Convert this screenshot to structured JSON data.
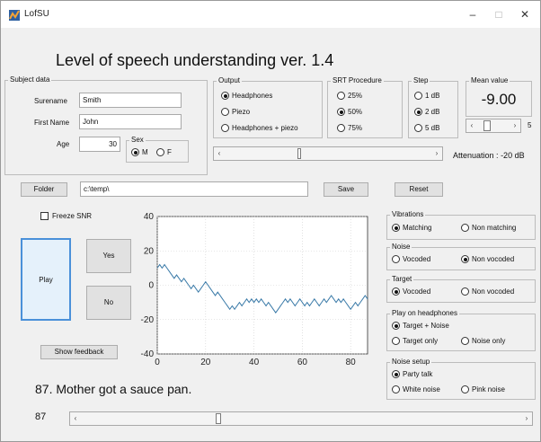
{
  "window": {
    "title": "LofSU",
    "minimize": "–",
    "maximize": "□",
    "close": "✕"
  },
  "header": {
    "title": "Level of speech understanding ver. 1.4"
  },
  "subject": {
    "group_label": "Subject data",
    "surename_label": "Surename",
    "surename_value": "Smith",
    "firstname_label": "First Name",
    "firstname_value": "John",
    "age_label": "Age",
    "age_value": "30",
    "sex": {
      "label": "Sex",
      "options": [
        {
          "label": "M",
          "selected": true
        },
        {
          "label": "F",
          "selected": false
        }
      ]
    }
  },
  "output": {
    "label": "Output",
    "options": [
      {
        "label": "Headphones",
        "selected": true
      },
      {
        "label": "Piezo",
        "selected": false
      },
      {
        "label": "Headphones + piezo",
        "selected": false
      }
    ]
  },
  "srt": {
    "label": "SRT Procedure",
    "options": [
      {
        "label": "25%",
        "selected": false
      },
      {
        "label": "50%",
        "selected": true
      },
      {
        "label": "75%",
        "selected": false
      }
    ]
  },
  "step": {
    "label": "Step",
    "options": [
      {
        "label": "1 dB",
        "selected": false
      },
      {
        "label": "2 dB",
        "selected": true
      },
      {
        "label": "5 dB",
        "selected": false
      }
    ]
  },
  "mean": {
    "label": "Mean value",
    "value": "-9.00",
    "slider_value": "5",
    "slider_fraction": 0.25
  },
  "attenuation": {
    "label": "Attenuation :",
    "value": "-20",
    "unit": "dB",
    "slider_fraction": 0.36
  },
  "toolbar": {
    "folder_label": "Folder",
    "folder_path": "c:\\temp\\",
    "save_label": "Save",
    "reset_label": "Reset"
  },
  "controls": {
    "freeze_label": "Freeze SNR",
    "freeze_checked": false,
    "play_label": "Play",
    "yes_label": "Yes",
    "no_label": "No",
    "feedback_label": "Show feedback"
  },
  "vibrations": {
    "label": "Vibrations",
    "options": [
      {
        "label": "Matching",
        "selected": true
      },
      {
        "label": "Non matching",
        "selected": false
      }
    ]
  },
  "noise": {
    "label": "Noise",
    "options": [
      {
        "label": "Vocoded",
        "selected": false
      },
      {
        "label": "Non vocoded",
        "selected": true
      }
    ]
  },
  "target": {
    "label": "Target",
    "options": [
      {
        "label": "Vocoded",
        "selected": true
      },
      {
        "label": "Non vocoded",
        "selected": false
      }
    ]
  },
  "play_on_headphones": {
    "label": "Play on headphones",
    "options": [
      {
        "label": "Target + Noise",
        "selected": true
      },
      {
        "label": "Target only",
        "selected": false
      },
      {
        "label": "Noise only",
        "selected": false
      }
    ]
  },
  "noise_setup": {
    "label": "Noise setup",
    "options": [
      {
        "label": "Party talk",
        "selected": true
      },
      {
        "label": "White noise",
        "selected": false
      },
      {
        "label": "Pink noise",
        "selected": false
      }
    ]
  },
  "sentence": {
    "text": "87. Mother got a sauce pan.",
    "index": "87",
    "slider_fraction": 0.31
  },
  "colors": {
    "series": "#3a7aa8",
    "window_bg": "#f0f0f0",
    "play_border": "#4a90d9",
    "play_bg": "#e5f1fb"
  },
  "chart_data": {
    "type": "line",
    "xlim": [
      0,
      87
    ],
    "ylim": [
      -40,
      40
    ],
    "x_ticks": [
      0,
      20,
      40,
      60,
      80
    ],
    "y_ticks": [
      40,
      20,
      0,
      -20,
      -40
    ],
    "grid": true,
    "series": [
      {
        "values": [
          10,
          12,
          10,
          12,
          10,
          8,
          6,
          4,
          6,
          4,
          2,
          4,
          2,
          0,
          -2,
          0,
          -2,
          -4,
          -2,
          0,
          2,
          0,
          -2,
          -4,
          -6,
          -4,
          -6,
          -8,
          -10,
          -12,
          -14,
          -12,
          -14,
          -12,
          -10,
          -12,
          -10,
          -8,
          -10,
          -8,
          -10,
          -8,
          -10,
          -8,
          -10,
          -12,
          -10,
          -12,
          -14,
          -16,
          -14,
          -12,
          -10,
          -8,
          -10,
          -8,
          -10,
          -12,
          -10,
          -8,
          -10,
          -12,
          -10,
          -12,
          -10,
          -8,
          -10,
          -12,
          -10,
          -8,
          -10,
          -8,
          -6,
          -8,
          -10,
          -8,
          -10,
          -8,
          -10,
          -12,
          -14,
          -12,
          -10,
          -12,
          -10,
          -8,
          -6,
          -8
        ]
      }
    ]
  }
}
